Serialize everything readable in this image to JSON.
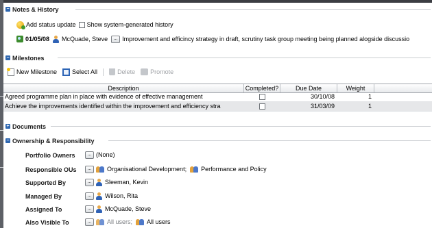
{
  "notes_history": {
    "title": "Notes & History",
    "add_status_update_label": "Add status update",
    "show_system_history_label": "Show system-generated history",
    "entry": {
      "date": "01/05/08",
      "author": "McQuade, Steve",
      "button_label": "...",
      "text": "Improvement and efficincy strategy in draft, scrutiny task group meeting being planned alogside discussio"
    }
  },
  "milestones": {
    "title": "Milestones",
    "toolbar": {
      "new_label": "New Milestone",
      "select_all_label": "Select All",
      "delete_label": "Delete",
      "promote_label": "Promote"
    },
    "columns": [
      "Description",
      "Completed?",
      "Due Date",
      "Weight"
    ],
    "rows": [
      {
        "description": "Agreed programme plan in place with evidence of effective management",
        "completed": false,
        "due_date": "30/10/08",
        "weight": "1"
      },
      {
        "description": "Achieve the improvements identified within the improvement and efficiency stra",
        "completed": false,
        "due_date": "31/03/09",
        "weight": "1"
      }
    ]
  },
  "documents": {
    "title": "Documents"
  },
  "ownership": {
    "title": "Ownership & Responsibility",
    "button_label": "...",
    "portfolio_owners": {
      "label": "Portfolio Owners",
      "value": "(None)"
    },
    "responsible_ous": {
      "label": "Responsible OUs",
      "value1": "Organisational Development;",
      "value2": "Performance and Policy"
    },
    "supported_by": {
      "label": "Supported By",
      "value": "Sleeman, Kevin"
    },
    "managed_by": {
      "label": "Managed By",
      "value": "Wilson, Rita"
    },
    "assigned_to": {
      "label": "Assigned To",
      "value": "McQuade, Steve"
    },
    "also_visible_to": {
      "label": "Also Visible To",
      "value1": "All users;",
      "value2": "All users"
    }
  },
  "colors": {
    "accent": "#2e67b1",
    "row_alt": "#e6e7e9",
    "border": "#9fa3a8"
  },
  "icons": [
    "toggle-minus-icon",
    "toggle-plus-icon",
    "add-status-icon",
    "status-note-icon",
    "person-icon",
    "group-icon",
    "new-milestone-icon",
    "select-all-icon",
    "delete-icon",
    "promote-icon"
  ]
}
